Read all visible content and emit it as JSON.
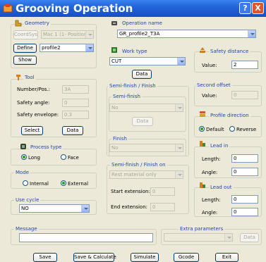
{
  "window": {
    "title": "Grooving Operation",
    "help_label": "?",
    "close_label": "X"
  },
  "geometry": {
    "title": "Geometry",
    "coord_sys_label": "CoordSys",
    "coord_sys_value": "Mac 1 (1- Position)",
    "define_label": "Define",
    "profile_value": "profile2",
    "show_label": "Show"
  },
  "operation_name": {
    "title": "Operation name",
    "value": "GR_profile2_T3A"
  },
  "tool": {
    "title": "Tool",
    "number_label": "Number/Pos.:",
    "number_value": "3A",
    "safety_angle_label": "Safety angle:",
    "safety_angle_value": "0",
    "safety_envelope_label": "Safety envelope:",
    "safety_envelope_value": "0.3",
    "select_label": "Select",
    "data_label": "Data"
  },
  "work_type": {
    "title": "Work type",
    "value": "CUT",
    "data_label": "Data"
  },
  "safety_distance": {
    "title": "Safety distance",
    "value_label": "Value:",
    "value": "2"
  },
  "semi_finish_finish": {
    "title": "Semi-finish / Finish",
    "semi_finish_title": "Semi-finish",
    "semi_finish_value": "No",
    "semi_finish_data_label": "Data",
    "finish_title": "Finish",
    "finish_value": "No"
  },
  "semi_finish_on": {
    "title": "Semi-finish / Finish on",
    "value": "Rest material only",
    "start_extension_label": "Start extension:",
    "start_extension_value": "0",
    "end_extension_label": "End extension:",
    "end_extension_value": "0"
  },
  "second_offset": {
    "title": "Second offset",
    "value_label": "Value:",
    "value": "0"
  },
  "profile_direction": {
    "title": "Profile direction",
    "default_label": "Default",
    "reverse_label": "Reverse",
    "selected": "Default"
  },
  "process_type": {
    "title": "Process type",
    "long_label": "Long",
    "face_label": "Face",
    "selected": "Long"
  },
  "mode": {
    "title": "Mode",
    "internal_label": "Internal",
    "external_label": "External",
    "selected": "External"
  },
  "use_cycle": {
    "title": "Use cycle",
    "value": "NO"
  },
  "lead_in": {
    "title": "Lead in",
    "length_label": "Length:",
    "length_value": "0",
    "angle_label": "Angle:",
    "angle_value": "0"
  },
  "lead_out": {
    "title": "Lead out",
    "length_label": "Length:",
    "length_value": "0",
    "angle_label": "Angle:",
    "angle_value": "0"
  },
  "message": {
    "title": "Message",
    "value": ""
  },
  "extra_parameters": {
    "title": "Extra parameters",
    "value": "",
    "data_label": "Data"
  },
  "footer": {
    "save_label": "Save",
    "save_calc_label": "Save & Calculate",
    "simulate_label": "Simulate",
    "gcode_label": "Gcode",
    "exit_label": "Exit"
  },
  "colors": {
    "titlebar": "#2264d8",
    "group_title": "#2148a8",
    "dialog_bg": "#ece9d8",
    "radio_dot": "#21a121"
  }
}
